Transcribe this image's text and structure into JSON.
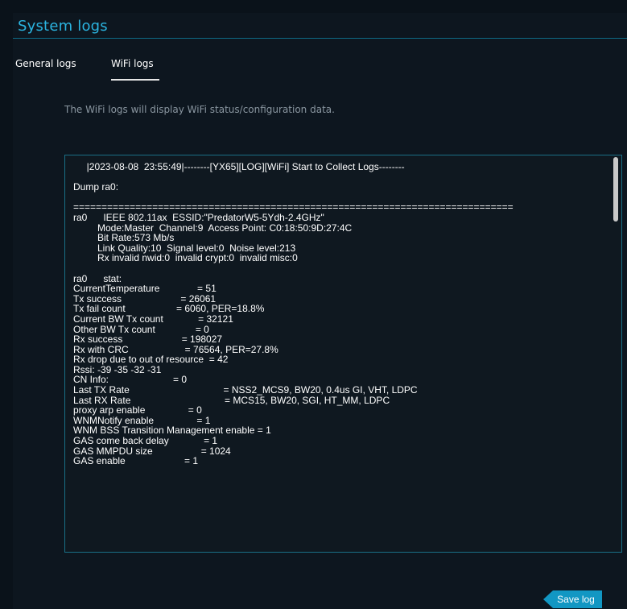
{
  "header": {
    "title": "System logs"
  },
  "tabs": [
    {
      "label": "General logs",
      "active": false
    },
    {
      "label": "WiFi logs",
      "active": true
    }
  ],
  "description": "The WiFi logs will display WiFi status/configuration data.",
  "log": {
    "text": "     |2023-08-08  23:55:49|--------[YX65][LOG][WiFi] Start to Collect Logs--------\n\nDump ra0:\n\n==============================================================================\nra0      IEEE 802.11ax  ESSID:\"PredatorW5-5Ydh-2.4GHz\"\n         Mode:Master  Channel:9  Access Point: C0:18:50:9D:27:4C\n         Bit Rate:573 Mb/s\n         Link Quality:10  Signal level:0  Noise level:213\n         Rx invalid nwid:0  invalid crypt:0  invalid misc:0\n\nra0      stat:\nCurrentTemperature              = 51\nTx success                      = 26061\nTx fail count                   = 6060, PER=18.8%\nCurrent BW Tx count             = 32121\nOther BW Tx count               = 0\nRx success                      = 198027\nRx with CRC                     = 76564, PER=27.8%\nRx drop due to out of resource  = 42\nRssi: -39 -35 -32 -31\nCN Info:                        = 0\nLast TX Rate                                   = NSS2_MCS9, BW20, 0.4us GI, VHT, LDPC\nLast RX Rate                                   = MCS15, BW20, SGI, HT_MM, LDPC\nproxy arp enable                = 0\nWNMNotify enable                = 1\nWNM BSS Transition Management enable = 1\nGAS come back delay             = 1\nGAS MMPDU size                  = 1024\nGAS enable                      = 1"
  },
  "buttons": {
    "save_log": "Save log"
  },
  "colors": {
    "accent": "#1297c3",
    "title": "#2bb4e0",
    "background": "#0d161f",
    "log_border": "#1a6f86"
  }
}
